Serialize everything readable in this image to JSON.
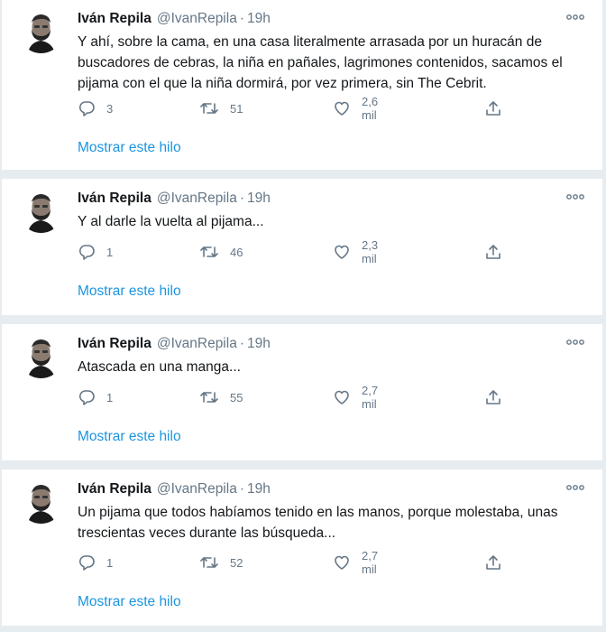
{
  "tweets": [
    {
      "author_name": "Iván Repila",
      "author_handle": "@IvanRepila",
      "separator": "·",
      "time": "19h",
      "text": "Y ahí, sobre la cama, en una casa literalmente arrasada por un huracán de buscadores de cebras, la niña en pañales, lagrimones contenidos, sacamos el pijama con el que la niña dormirá, por vez primera, sin The Cebrit.",
      "replies": "3",
      "retweets": "51",
      "likes": "2,6 mil",
      "thread_link": "Mostrar este hilo"
    },
    {
      "author_name": "Iván Repila",
      "author_handle": "@IvanRepila",
      "separator": "·",
      "time": "19h",
      "text": "Y al darle la vuelta al pijama...",
      "replies": "1",
      "retweets": "46",
      "likes": "2,3 mil",
      "thread_link": "Mostrar este hilo"
    },
    {
      "author_name": "Iván Repila",
      "author_handle": "@IvanRepila",
      "separator": "·",
      "time": "19h",
      "text": "Atascada en una manga...",
      "replies": "1",
      "retweets": "55",
      "likes": "2,7 mil",
      "thread_link": "Mostrar este hilo"
    },
    {
      "author_name": "Iván Repila",
      "author_handle": "@IvanRepila",
      "separator": "·",
      "time": "19h",
      "text": "Un pijama que todos habíamos tenido en las manos, porque molestaba, unas trescientas veces durante las búsqueda...",
      "replies": "1",
      "retweets": "52",
      "likes": "2,7 mil",
      "thread_link": "Mostrar este hilo"
    }
  ],
  "icons": {
    "avatar": "avatar-photo",
    "more": "more-options-icon",
    "reply": "reply-icon",
    "retweet": "retweet-icon",
    "like": "like-icon",
    "share": "share-icon"
  },
  "colors": {
    "link": "#1b95e0",
    "secondary_text": "#657786",
    "primary_text": "#14171a",
    "divider": "#e6ecf0"
  }
}
